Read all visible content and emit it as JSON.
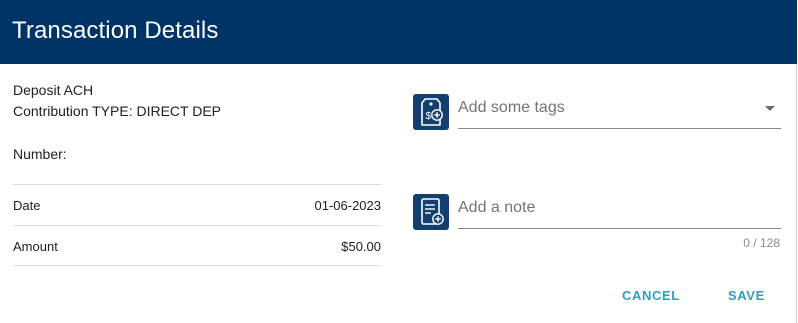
{
  "dialog": {
    "title": "Transaction Details"
  },
  "summary": {
    "type_line": "Deposit ACH",
    "contribution_line": "Contribution TYPE: DIRECT DEP",
    "number_label": "Number:"
  },
  "details": [
    {
      "label": "Date",
      "value": "01-06-2023"
    },
    {
      "label": "Amount",
      "value": "$50.00"
    }
  ],
  "tags": {
    "placeholder": "Add some tags",
    "icon": "tag-add-icon"
  },
  "note": {
    "placeholder": "Add a note",
    "counter": "0 / 128",
    "icon": "note-add-icon"
  },
  "actions": {
    "cancel_label": "CANCEL",
    "save_label": "SAVE"
  },
  "colors": {
    "header_bg": "#003466",
    "icon_bg": "#123f6e",
    "action_text": "#2f9fc0"
  }
}
